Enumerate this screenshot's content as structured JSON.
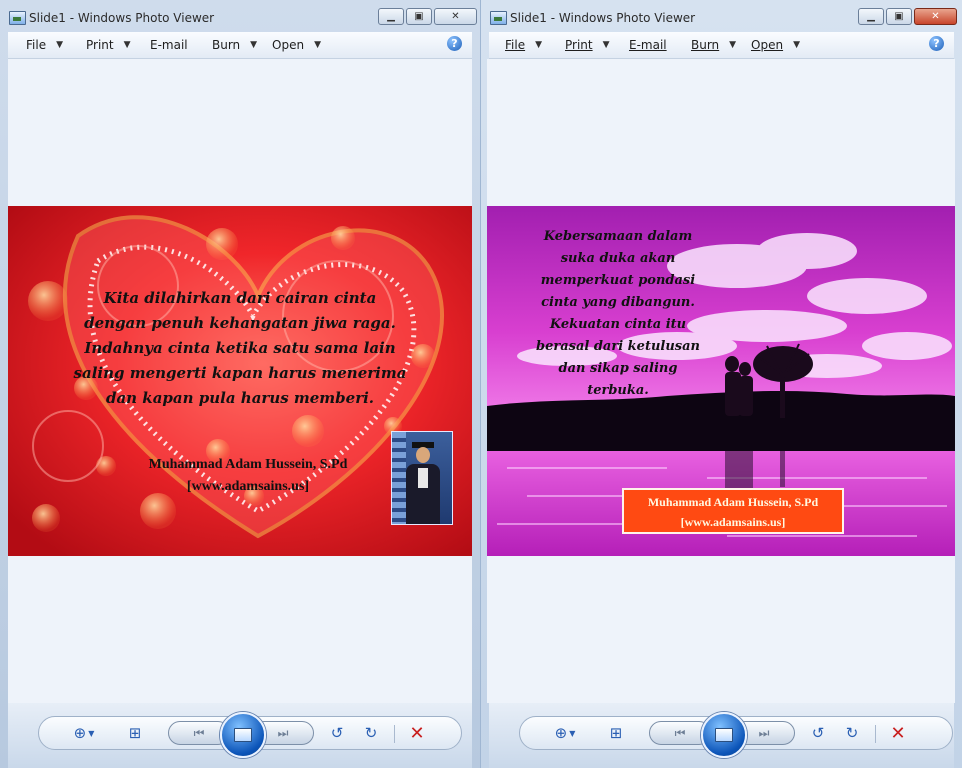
{
  "windows": [
    {
      "title": "Slide1 - Windows Photo Viewer",
      "menu": [
        {
          "label": "File"
        },
        {
          "label": "Print"
        },
        {
          "label": "E-mail"
        },
        {
          "label": "Burn"
        },
        {
          "label": "Open"
        }
      ],
      "help_label": "?",
      "photo": {
        "quote_lines": [
          "Kita dilahirkan dari cairan cinta",
          "dengan penuh kehangatan jiwa raga.",
          "Indahnya cinta ketika satu sama lain",
          "saling mengerti kapan harus menerima",
          "dan kapan pula harus memberi."
        ],
        "author": "Muhammad Adam Hussein, S.Pd",
        "website": "[www.adamsains.us]"
      }
    },
    {
      "title": "Slide1 - Windows Photo Viewer",
      "menu": [
        {
          "label": "File"
        },
        {
          "label": "Print"
        },
        {
          "label": "E-mail"
        },
        {
          "label": "Burn"
        },
        {
          "label": "Open"
        }
      ],
      "help_label": "?",
      "photo": {
        "quote_lines": [
          "Kebersamaan dalam",
          "suka duka akan",
          "memperkuat pondasi",
          "cinta yang dibangun.",
          "Kekuatan cinta itu",
          "berasal dari ketulusan",
          "dan sikap saling",
          "terbuka."
        ],
        "author": "Muhammad Adam Hussein, S.Pd",
        "website": "[www.adamsains.us]"
      }
    }
  ],
  "colors": {
    "accent_blue": "#1d5fb8",
    "delete_red": "#c81e1e",
    "photo1_bg": "#e01c1c",
    "photo2_bg": "#c21ec8",
    "author_box": "#ff4a12"
  },
  "icons": [
    "app-icon",
    "minimize-icon",
    "maximize-icon",
    "close-icon",
    "help-icon",
    "zoom-icon",
    "actual-size-icon",
    "previous-icon",
    "slideshow-icon",
    "next-icon",
    "rotate-left-icon",
    "rotate-right-icon",
    "delete-icon"
  ]
}
